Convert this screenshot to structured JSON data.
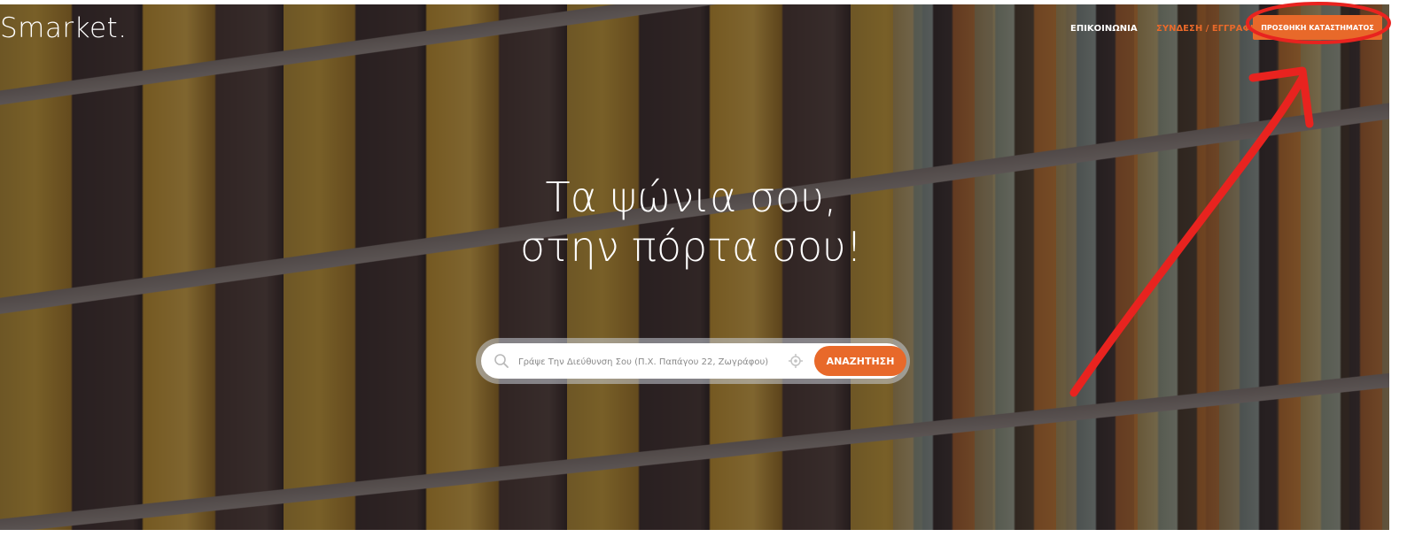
{
  "brand": {
    "logo_text": "Smarket",
    "logo_dot": "."
  },
  "nav": {
    "contact_label": "ΕΠΙΚΟΙΝΩΝΙΑ",
    "login_label": "ΣΥΝΔΕΣΗ / ΕΓΓΡΑΦΗ",
    "add_store_label": "ΠΡΟΣΘΗΚΗ ΚΑΤΑΣΤΗΜΑΤΟΣ"
  },
  "hero": {
    "headline_line1": "Τα ψώνια σου,",
    "headline_line2": "στην πόρτα σου!"
  },
  "search": {
    "placeholder": "Γράψε Την Διεύθυνση Σου (Π.Χ. Παπάγου 22, Ζωγράφου)",
    "value": "",
    "button_label": "ΑΝΑΖΗΤΗΣΗ",
    "search_icon": "search-icon",
    "locate_icon": "locate-icon"
  },
  "colors": {
    "accent": "#e8692a",
    "annotation_red": "#e8231f"
  }
}
